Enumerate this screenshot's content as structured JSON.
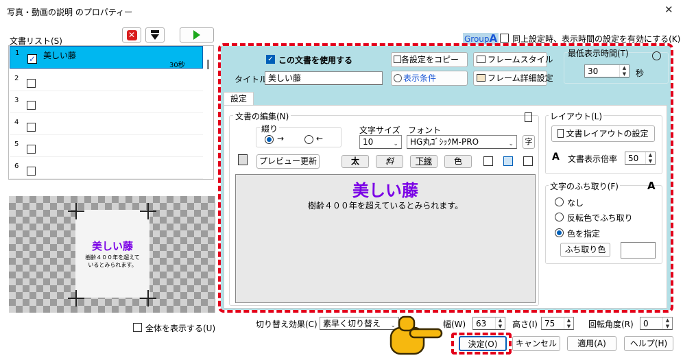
{
  "window": {
    "title": "写真・動画の説明 のプロパティー",
    "close_glyph": "✕"
  },
  "doclist": {
    "label": "文書リスト(S)",
    "items": [
      {
        "num": "1",
        "name": "美しい藤",
        "duration": "30秒"
      },
      {
        "num": "2"
      },
      {
        "num": "3"
      },
      {
        "num": "4"
      },
      {
        "num": "5"
      },
      {
        "num": "6"
      }
    ]
  },
  "preview": {
    "title": "美しい藤",
    "body_line1": "樹齢４００年を超えて",
    "body_line2": "いるとみられます。"
  },
  "show_all_label": "全体を表示する(U)",
  "group": {
    "badge_text": "Group",
    "badge_letter": "A",
    "sync_label": "同上設定時、表示時間の設定を有効にする(K)"
  },
  "panel": {
    "use_doc_label": "この文書を使用する",
    "copy_settings": "各設定をコピー",
    "frame_style": "フレームスタイル",
    "title_label": "タイトル",
    "title_value": "美しい藤",
    "display_cond": "表示条件",
    "frame_detail": "フレーム詳細設定",
    "min_time_label": "最低表示時間(T)",
    "min_time_value": "30",
    "sec_unit": "秒",
    "tab": "設定"
  },
  "edit": {
    "group_label": "文書の編集(N)",
    "direction_label": "綴り",
    "dir_right": "→",
    "dir_left": "←",
    "size_label": "文字サイズ",
    "size_value": "10",
    "font_label": "フォント",
    "font_value": "HG丸ｺﾞｼｯｸM-PRO",
    "font_btn": "字",
    "preview_update": "プレビュー更新",
    "bold": "太",
    "italic": "斜",
    "underline": "下線",
    "color": "色",
    "text_title": "美しい藤",
    "text_body": "樹齢４００年を超えているとみられます。"
  },
  "layout": {
    "group_label": "レイアウト(L)",
    "layout_btn": "文書レイアウトの設定",
    "scale_label": "文書表示倍率",
    "scale_value": "50"
  },
  "outline": {
    "group_label": "文字のふち取り(F)",
    "opt_none": "なし",
    "opt_invert": "反転色でふち取り",
    "opt_color": "色を指定",
    "color_btn": "ふち取り色"
  },
  "bottom": {
    "transition_label": "切り替え効果(C)",
    "transition_value": "素早く切り替え",
    "width_label": "幅(W)",
    "width_value": "63",
    "height_label": "高さ(I)",
    "height_value": "75",
    "rotation_label": "回転角度(R)",
    "rotation_value": "0",
    "ok": "決定(O)",
    "cancel": "キャンセル",
    "apply": "適用(A)",
    "help": "ヘルプ(H)"
  },
  "colors": {
    "accent": "#005fb8",
    "selected_row": "#00b7f0",
    "panel_bg": "#b3dfe6",
    "highlight_dash": "#e3001b",
    "title_purple": "#7a00e6"
  }
}
